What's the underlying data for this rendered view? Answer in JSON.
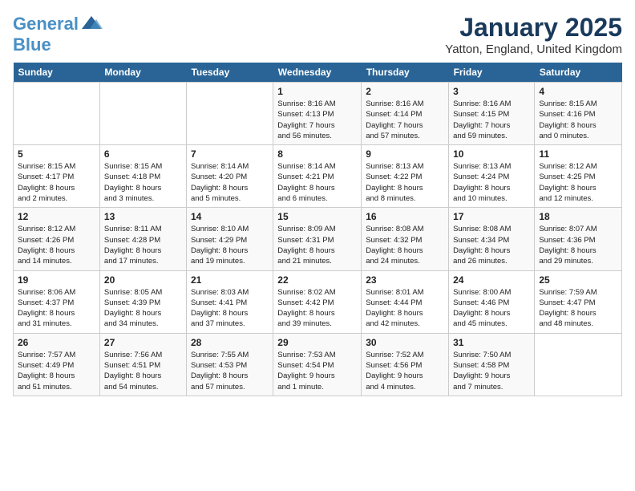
{
  "header": {
    "logo_line1": "General",
    "logo_line2": "Blue",
    "month": "January 2025",
    "location": "Yatton, England, United Kingdom"
  },
  "days_of_week": [
    "Sunday",
    "Monday",
    "Tuesday",
    "Wednesday",
    "Thursday",
    "Friday",
    "Saturday"
  ],
  "weeks": [
    [
      {
        "day": "",
        "info": ""
      },
      {
        "day": "",
        "info": ""
      },
      {
        "day": "",
        "info": ""
      },
      {
        "day": "1",
        "info": "Sunrise: 8:16 AM\nSunset: 4:13 PM\nDaylight: 7 hours\nand 56 minutes."
      },
      {
        "day": "2",
        "info": "Sunrise: 8:16 AM\nSunset: 4:14 PM\nDaylight: 7 hours\nand 57 minutes."
      },
      {
        "day": "3",
        "info": "Sunrise: 8:16 AM\nSunset: 4:15 PM\nDaylight: 7 hours\nand 59 minutes."
      },
      {
        "day": "4",
        "info": "Sunrise: 8:15 AM\nSunset: 4:16 PM\nDaylight: 8 hours\nand 0 minutes."
      }
    ],
    [
      {
        "day": "5",
        "info": "Sunrise: 8:15 AM\nSunset: 4:17 PM\nDaylight: 8 hours\nand 2 minutes."
      },
      {
        "day": "6",
        "info": "Sunrise: 8:15 AM\nSunset: 4:18 PM\nDaylight: 8 hours\nand 3 minutes."
      },
      {
        "day": "7",
        "info": "Sunrise: 8:14 AM\nSunset: 4:20 PM\nDaylight: 8 hours\nand 5 minutes."
      },
      {
        "day": "8",
        "info": "Sunrise: 8:14 AM\nSunset: 4:21 PM\nDaylight: 8 hours\nand 6 minutes."
      },
      {
        "day": "9",
        "info": "Sunrise: 8:13 AM\nSunset: 4:22 PM\nDaylight: 8 hours\nand 8 minutes."
      },
      {
        "day": "10",
        "info": "Sunrise: 8:13 AM\nSunset: 4:24 PM\nDaylight: 8 hours\nand 10 minutes."
      },
      {
        "day": "11",
        "info": "Sunrise: 8:12 AM\nSunset: 4:25 PM\nDaylight: 8 hours\nand 12 minutes."
      }
    ],
    [
      {
        "day": "12",
        "info": "Sunrise: 8:12 AM\nSunset: 4:26 PM\nDaylight: 8 hours\nand 14 minutes."
      },
      {
        "day": "13",
        "info": "Sunrise: 8:11 AM\nSunset: 4:28 PM\nDaylight: 8 hours\nand 17 minutes."
      },
      {
        "day": "14",
        "info": "Sunrise: 8:10 AM\nSunset: 4:29 PM\nDaylight: 8 hours\nand 19 minutes."
      },
      {
        "day": "15",
        "info": "Sunrise: 8:09 AM\nSunset: 4:31 PM\nDaylight: 8 hours\nand 21 minutes."
      },
      {
        "day": "16",
        "info": "Sunrise: 8:08 AM\nSunset: 4:32 PM\nDaylight: 8 hours\nand 24 minutes."
      },
      {
        "day": "17",
        "info": "Sunrise: 8:08 AM\nSunset: 4:34 PM\nDaylight: 8 hours\nand 26 minutes."
      },
      {
        "day": "18",
        "info": "Sunrise: 8:07 AM\nSunset: 4:36 PM\nDaylight: 8 hours\nand 29 minutes."
      }
    ],
    [
      {
        "day": "19",
        "info": "Sunrise: 8:06 AM\nSunset: 4:37 PM\nDaylight: 8 hours\nand 31 minutes."
      },
      {
        "day": "20",
        "info": "Sunrise: 8:05 AM\nSunset: 4:39 PM\nDaylight: 8 hours\nand 34 minutes."
      },
      {
        "day": "21",
        "info": "Sunrise: 8:03 AM\nSunset: 4:41 PM\nDaylight: 8 hours\nand 37 minutes."
      },
      {
        "day": "22",
        "info": "Sunrise: 8:02 AM\nSunset: 4:42 PM\nDaylight: 8 hours\nand 39 minutes."
      },
      {
        "day": "23",
        "info": "Sunrise: 8:01 AM\nSunset: 4:44 PM\nDaylight: 8 hours\nand 42 minutes."
      },
      {
        "day": "24",
        "info": "Sunrise: 8:00 AM\nSunset: 4:46 PM\nDaylight: 8 hours\nand 45 minutes."
      },
      {
        "day": "25",
        "info": "Sunrise: 7:59 AM\nSunset: 4:47 PM\nDaylight: 8 hours\nand 48 minutes."
      }
    ],
    [
      {
        "day": "26",
        "info": "Sunrise: 7:57 AM\nSunset: 4:49 PM\nDaylight: 8 hours\nand 51 minutes."
      },
      {
        "day": "27",
        "info": "Sunrise: 7:56 AM\nSunset: 4:51 PM\nDaylight: 8 hours\nand 54 minutes."
      },
      {
        "day": "28",
        "info": "Sunrise: 7:55 AM\nSunset: 4:53 PM\nDaylight: 8 hours\nand 57 minutes."
      },
      {
        "day": "29",
        "info": "Sunrise: 7:53 AM\nSunset: 4:54 PM\nDaylight: 9 hours\nand 1 minute."
      },
      {
        "day": "30",
        "info": "Sunrise: 7:52 AM\nSunset: 4:56 PM\nDaylight: 9 hours\nand 4 minutes."
      },
      {
        "day": "31",
        "info": "Sunrise: 7:50 AM\nSunset: 4:58 PM\nDaylight: 9 hours\nand 7 minutes."
      },
      {
        "day": "",
        "info": ""
      }
    ]
  ]
}
